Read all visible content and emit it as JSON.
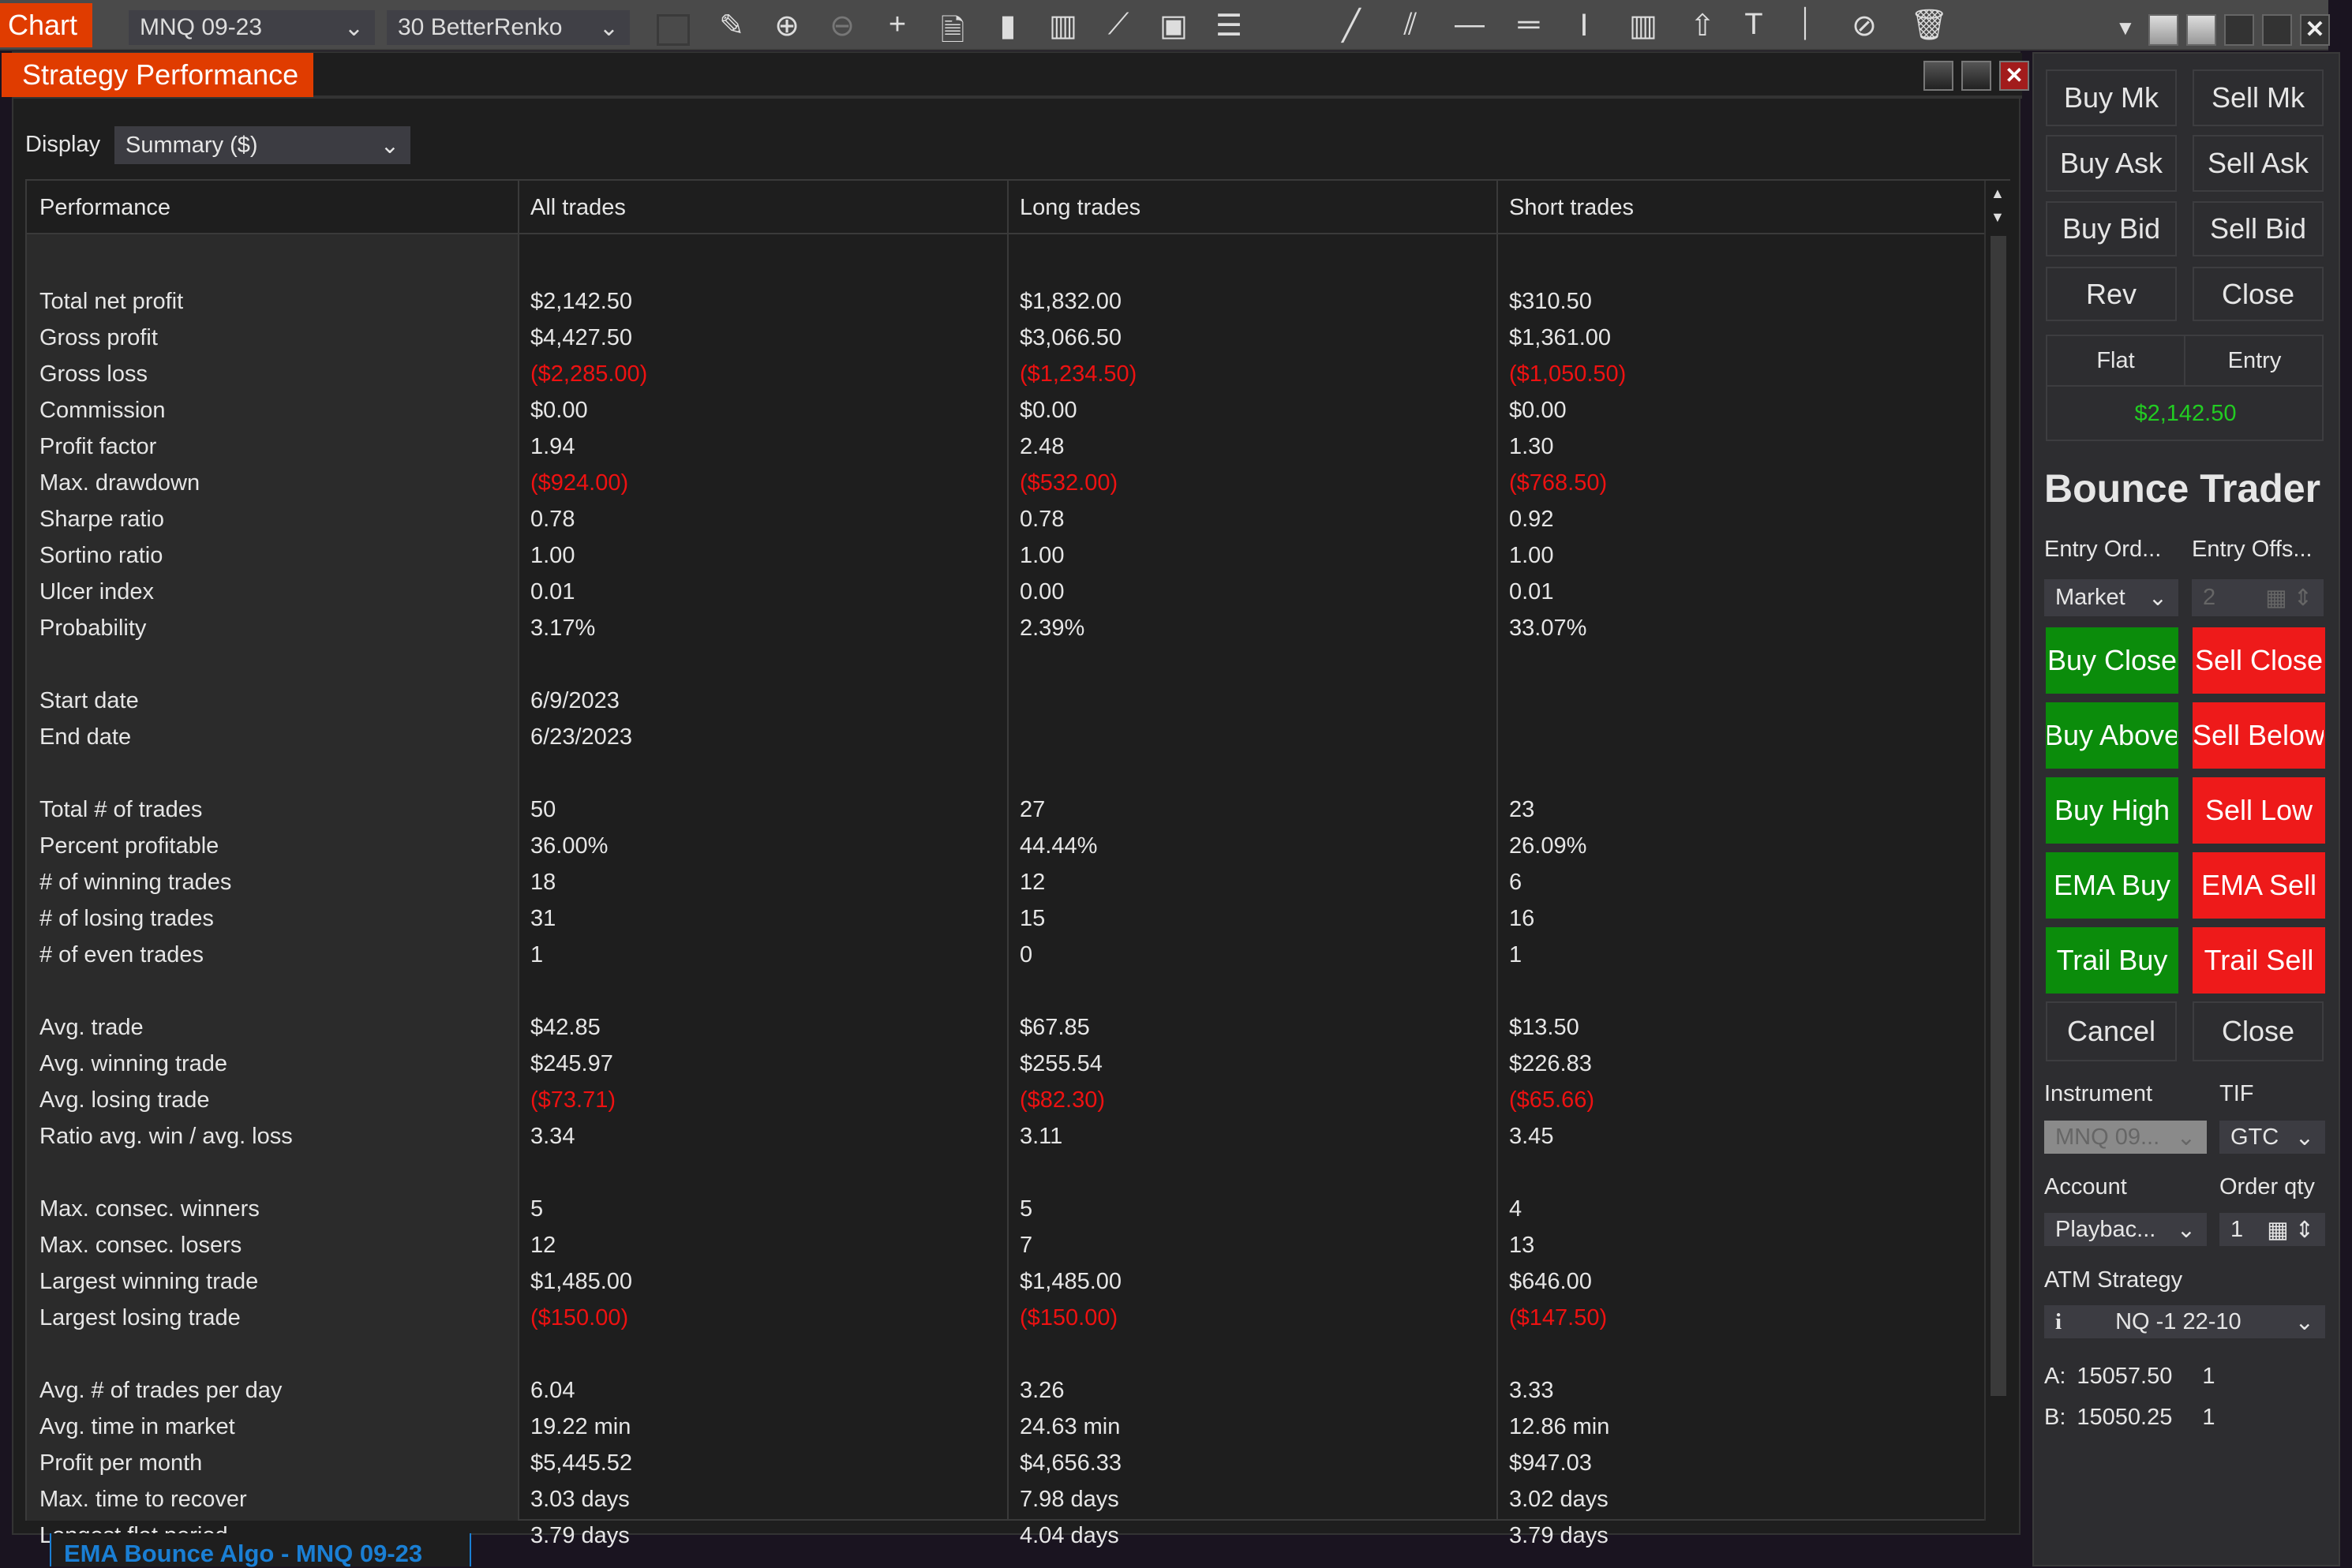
{
  "toolbar": {
    "chart_tab": "Chart",
    "instrument": "MNQ 09-23",
    "bar_type": "30 BetterRenko",
    "icons": [
      "pencil-icon",
      "zoom-in-icon",
      "zoom-out-icon",
      "crosshair-icon",
      "data-box-icon",
      "chart-properties-icon",
      "bar-chart-icon",
      "indicators-icon",
      "strategies-icon",
      "list-icon",
      "line-icon",
      "parallel-lines-icon",
      "horizontal-line-icon",
      "double-horizontal-icon",
      "range-icon",
      "ruler-icon",
      "arrow-up-icon",
      "text-icon",
      "volume-icon",
      "hide-icon",
      "trash-icon"
    ]
  },
  "panel": {
    "title": "Strategy Performance",
    "display_label": "Display",
    "display_value": "Summary ($)",
    "bottom_tab": "EMA Bounce Algo - MNQ 09-23"
  },
  "table": {
    "headers": [
      "Performance",
      "All trades",
      "Long trades",
      "Short trades"
    ],
    "rows": [
      {
        "label": "Total net profit",
        "values": [
          "$2,142.50",
          "$1,832.00",
          "$310.50"
        ]
      },
      {
        "label": "Gross profit",
        "values": [
          "$4,427.50",
          "$3,066.50",
          "$1,361.00"
        ]
      },
      {
        "label": "Gross loss",
        "values": [
          "($2,285.00)",
          "($1,234.50)",
          "($1,050.50)"
        ],
        "negative": true
      },
      {
        "label": "Commission",
        "values": [
          "$0.00",
          "$0.00",
          "$0.00"
        ]
      },
      {
        "label": "Profit factor",
        "values": [
          "1.94",
          "2.48",
          "1.30"
        ]
      },
      {
        "label": "Max. drawdown",
        "values": [
          "($924.00)",
          "($532.00)",
          "($768.50)"
        ],
        "negative": true
      },
      {
        "label": "Sharpe ratio",
        "values": [
          "0.78",
          "0.78",
          "0.92"
        ]
      },
      {
        "label": "Sortino ratio",
        "values": [
          "1.00",
          "1.00",
          "1.00"
        ]
      },
      {
        "label": "Ulcer index",
        "values": [
          "0.01",
          "0.00",
          "0.01"
        ]
      },
      {
        "label": "Probability",
        "values": [
          "3.17%",
          "2.39%",
          "33.07%"
        ]
      },
      null,
      {
        "label": "Start date",
        "values": [
          "6/9/2023",
          "",
          ""
        ]
      },
      {
        "label": "End date",
        "values": [
          "6/23/2023",
          "",
          ""
        ]
      },
      null,
      {
        "label": "Total # of trades",
        "values": [
          "50",
          "27",
          "23"
        ]
      },
      {
        "label": "Percent profitable",
        "values": [
          "36.00%",
          "44.44%",
          "26.09%"
        ]
      },
      {
        "label": "# of winning trades",
        "values": [
          "18",
          "12",
          "6"
        ]
      },
      {
        "label": "# of losing trades",
        "values": [
          "31",
          "15",
          "16"
        ]
      },
      {
        "label": "# of even trades",
        "values": [
          "1",
          "0",
          "1"
        ]
      },
      null,
      {
        "label": "Avg. trade",
        "values": [
          "$42.85",
          "$67.85",
          "$13.50"
        ]
      },
      {
        "label": "Avg. winning trade",
        "values": [
          "$245.97",
          "$255.54",
          "$226.83"
        ]
      },
      {
        "label": "Avg. losing trade",
        "values": [
          "($73.71)",
          "($82.30)",
          "($65.66)"
        ],
        "negative": true
      },
      {
        "label": "Ratio avg. win / avg. loss",
        "values": [
          "3.34",
          "3.11",
          "3.45"
        ]
      },
      null,
      {
        "label": "Max. consec. winners",
        "values": [
          "5",
          "5",
          "4"
        ]
      },
      {
        "label": "Max. consec. losers",
        "values": [
          "12",
          "7",
          "13"
        ]
      },
      {
        "label": "Largest winning trade",
        "values": [
          "$1,485.00",
          "$1,485.00",
          "$646.00"
        ]
      },
      {
        "label": "Largest losing trade",
        "values": [
          "($150.00)",
          "($150.00)",
          "($147.50)"
        ],
        "negative": true
      },
      null,
      {
        "label": "Avg. # of trades per day",
        "values": [
          "6.04",
          "3.26",
          "3.33"
        ]
      },
      {
        "label": "Avg. time in market",
        "values": [
          "19.22 min",
          "24.63 min",
          "12.86 min"
        ]
      },
      {
        "label": "Profit per month",
        "values": [
          "$5,445.52",
          "$4,656.33",
          "$947.03"
        ]
      },
      {
        "label": "Max. time to recover",
        "values": [
          "3.03 days",
          "7.98 days",
          "3.02 days"
        ]
      },
      {
        "label": "Longest flat period",
        "values": [
          "3.79 days",
          "4.04 days",
          "3.79 days"
        ]
      }
    ]
  },
  "right": {
    "buttons": {
      "buy_mk": "Buy Mk",
      "sell_mk": "Sell Mk",
      "buy_ask": "Buy Ask",
      "sell_ask": "Sell Ask",
      "buy_bid": "Buy Bid",
      "sell_bid": "Sell Bid",
      "rev": "Rev",
      "close": "Close"
    },
    "position": {
      "flat": "Flat",
      "entry": "Entry",
      "pnl": "$2,142.50"
    },
    "title": "Bounce Trader",
    "entry_order_label": "Entry Ord...",
    "entry_offset_label": "Entry Offs...",
    "entry_order_value": "Market",
    "entry_offset_value": "2",
    "actions": [
      [
        "Buy Close",
        "Sell Close"
      ],
      [
        "Buy Above",
        "Sell Below"
      ],
      [
        "Buy High",
        "Sell Low"
      ],
      [
        "EMA Buy",
        "EMA Sell"
      ],
      [
        "Trail Buy",
        "Trail Sell"
      ]
    ],
    "cancel": "Cancel",
    "close2": "Close",
    "instrument_label": "Instrument",
    "instrument_value": "MNQ 09...",
    "tif_label": "TIF",
    "tif_value": "GTC",
    "account_label": "Account",
    "account_value": "Playbac...",
    "qty_label": "Order qty",
    "qty_value": "1",
    "atm_label": "ATM Strategy",
    "atm_value": "NQ -1 22-10",
    "ask": {
      "label": "A:",
      "price": "15057.50",
      "size": "1"
    },
    "bid": {
      "label": "B:",
      "price": "15050.25",
      "size": "1"
    }
  },
  "colors": {
    "accent": "#e03c00",
    "buy": "#0b8c0b",
    "sell": "#ee1a1a",
    "negative": "#ee1111",
    "pnl": "#22cc22",
    "tab_text": "#1a7fd4"
  }
}
